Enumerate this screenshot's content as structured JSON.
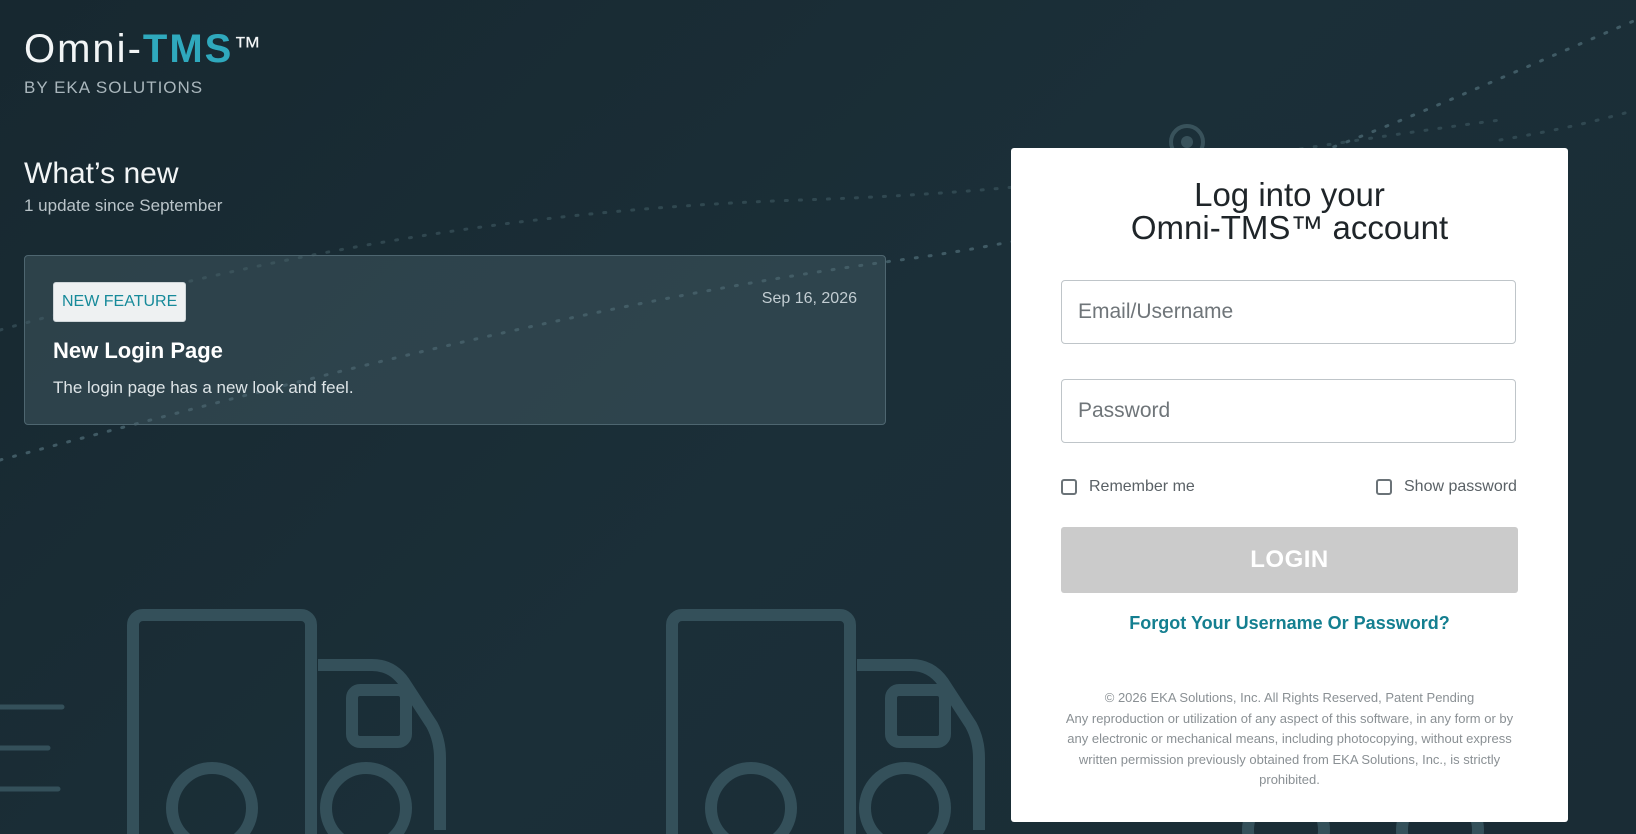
{
  "brand": {
    "name_prefix": "Omni-",
    "name_accent": "TMS",
    "trademark": "™",
    "byline": "BY EKA SOLUTIONS"
  },
  "whats_new": {
    "title": "What’s new",
    "subtitle": "1 update since September",
    "updates": [
      {
        "badge": "NEW FEATURE",
        "date": "Sep 16, 2026",
        "title": "New Login Page",
        "description": "The login page has a new look and feel."
      }
    ]
  },
  "login": {
    "heading_line1": "Log into your",
    "heading_line2": "Omni-TMS™ account",
    "email_placeholder": "Email/Username",
    "password_placeholder": "Password",
    "remember_label": "Remember me",
    "show_password_label": "Show password",
    "remember_checked": false,
    "show_password_checked": false,
    "login_button": "LOGIN",
    "forgot_link": "Forgot Your Username Or Password?",
    "copyright": "© 2026 EKA Solutions, Inc. All Rights Reserved, Patent Pending",
    "legal_notice": "Any reproduction or utilization of any aspect of this software, in any form or by any electronic or mechanical means, including photocopying, without express written permission previously obtained from EKA Solutions, Inc., is strictly prohibited."
  },
  "colors": {
    "background": "#1b2f38",
    "accent": "#2fa9bd",
    "link": "#147f90",
    "button_disabled": "#cbcbcb",
    "badge_text": "#168a9a"
  },
  "icons": [
    "truck-icon",
    "truck-icon",
    "location-pin-icon"
  ]
}
